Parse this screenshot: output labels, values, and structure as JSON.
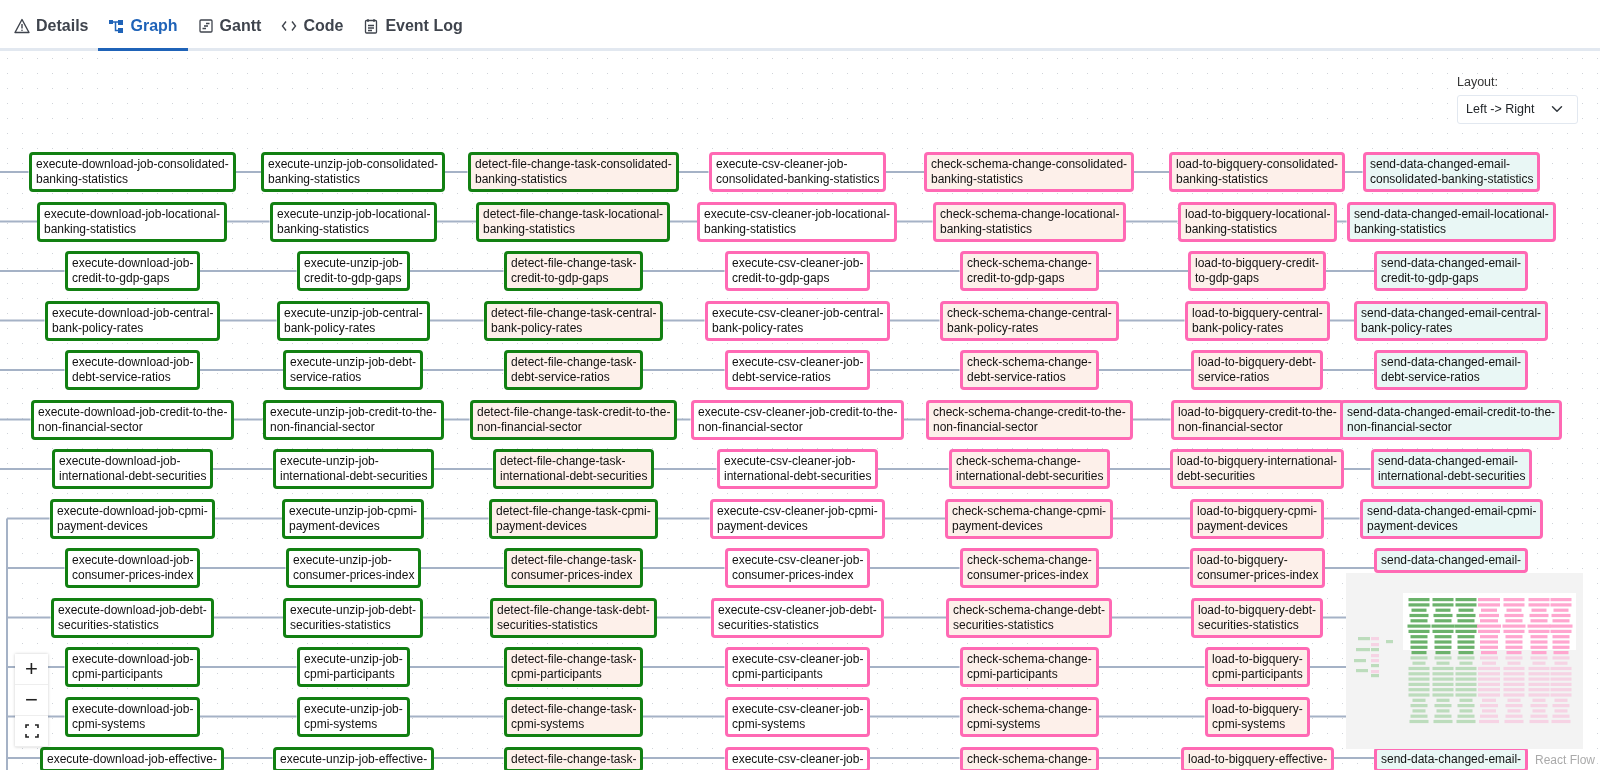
{
  "tabs": [
    {
      "label": "Details",
      "kind": "details",
      "selected": false
    },
    {
      "label": "Graph",
      "kind": "graph",
      "selected": true
    },
    {
      "label": "Gantt",
      "kind": "gantt",
      "selected": false
    },
    {
      "label": "Code",
      "kind": "code",
      "selected": false
    },
    {
      "label": "Event Log",
      "kind": "log",
      "selected": false
    }
  ],
  "layout": {
    "label": "Layout:",
    "value": "Left -> Right"
  },
  "graph": {
    "columns": [
      {
        "color": "#128012",
        "kind": "bash"
      },
      {
        "color": "#128012",
        "kind": "bash"
      },
      {
        "color": "#128012",
        "kind": "python"
      },
      {
        "color": "#ff69b4",
        "kind": "bash"
      },
      {
        "color": "#ff69b4",
        "kind": "python"
      },
      {
        "color": "#ff69b4",
        "kind": "python"
      },
      {
        "color": "#ff69b4",
        "kind": "email"
      }
    ],
    "rows": [
      {
        "nodes": [
          "execute-download-job-consolidated-\nbanking-statistics",
          "execute-unzip-job-consolidated-\nbanking-statistics",
          "detect-file-change-task-consolidated-\nbanking-statistics",
          "execute-csv-cleaner-job-\nconsolidated-banking-statistics",
          "check-schema-change-consolidated-\nbanking-statistics",
          "load-to-bigquery-consolidated-\nbanking-statistics",
          "send-data-changed-email-\nconsolidated-banking-statistics"
        ]
      },
      {
        "nodes": [
          "execute-download-job-locational-\nbanking-statistics",
          "execute-unzip-job-locational-\nbanking-statistics",
          "detect-file-change-task-locational-\nbanking-statistics",
          "execute-csv-cleaner-job-locational-\nbanking-statistics",
          "check-schema-change-locational-\nbanking-statistics",
          "load-to-bigquery-locational-\nbanking-statistics",
          "send-data-changed-email-locational-\nbanking-statistics"
        ]
      },
      {
        "nodes": [
          "execute-download-job-\ncredit-to-gdp-gaps",
          "execute-unzip-job-\ncredit-to-gdp-gaps",
          "detect-file-change-task-\ncredit-to-gdp-gaps",
          "execute-csv-cleaner-job-\ncredit-to-gdp-gaps",
          "check-schema-change-\ncredit-to-gdp-gaps",
          "load-to-bigquery-credit-\nto-gdp-gaps",
          "send-data-changed-email-\ncredit-to-gdp-gaps"
        ]
      },
      {
        "nodes": [
          "execute-download-job-central-\nbank-policy-rates",
          "execute-unzip-job-central-\nbank-policy-rates",
          "detect-file-change-task-central-\nbank-policy-rates",
          "execute-csv-cleaner-job-central-\nbank-policy-rates",
          "check-schema-change-central-\nbank-policy-rates",
          "load-to-bigquery-central-\nbank-policy-rates",
          "send-data-changed-email-central-\nbank-policy-rates"
        ]
      },
      {
        "nodes": [
          "execute-download-job-\ndebt-service-ratios",
          "execute-unzip-job-debt-\nservice-ratios",
          "detect-file-change-task-\ndebt-service-ratios",
          "execute-csv-cleaner-job-\ndebt-service-ratios",
          "check-schema-change-\ndebt-service-ratios",
          "load-to-bigquery-debt-\nservice-ratios",
          "send-data-changed-email-\ndebt-service-ratios"
        ]
      },
      {
        "nodes": [
          "execute-download-job-credit-to-the-\nnon-financial-sector",
          "execute-unzip-job-credit-to-the-\nnon-financial-sector",
          "detect-file-change-task-credit-to-the-\nnon-financial-sector",
          "execute-csv-cleaner-job-credit-to-the-\nnon-financial-sector",
          "check-schema-change-credit-to-the-\nnon-financial-sector",
          "load-to-bigquery-credit-to-the-\nnon-financial-sector",
          "send-data-changed-email-credit-to-the-\nnon-financial-sector"
        ]
      },
      {
        "nodes": [
          "execute-download-job-\ninternational-debt-securities",
          "execute-unzip-job-\ninternational-debt-securities",
          "detect-file-change-task-\ninternational-debt-securities",
          "execute-csv-cleaner-job-\ninternational-debt-securities",
          "check-schema-change-\ninternational-debt-securities",
          "load-to-bigquery-international-\ndebt-securities",
          "send-data-changed-email-\ninternational-debt-securities"
        ]
      },
      {
        "nodes": [
          "execute-download-job-cpmi-\npayment-devices",
          "execute-unzip-job-cpmi-\npayment-devices",
          "detect-file-change-task-cpmi-\npayment-devices",
          "execute-csv-cleaner-job-cpmi-\npayment-devices",
          "check-schema-change-cpmi-\npayment-devices",
          "load-to-bigquery-cpmi-\npayment-devices",
          "send-data-changed-email-cpmi-\npayment-devices"
        ]
      },
      {
        "nodes": [
          "execute-download-job-\nconsumer-prices-index",
          "execute-unzip-job-\nconsumer-prices-index",
          "detect-file-change-task-\nconsumer-prices-index",
          "execute-csv-cleaner-job-\nconsumer-prices-index",
          "check-schema-change-\nconsumer-prices-index",
          "load-to-bigquery-\nconsumer-prices-index",
          "send-data-changed-email-"
        ]
      },
      {
        "nodes": [
          "execute-download-job-debt-\nsecurities-statistics",
          "execute-unzip-job-debt-\nsecurities-statistics",
          "detect-file-change-task-debt-\nsecurities-statistics",
          "execute-csv-cleaner-job-debt-\nsecurities-statistics",
          "check-schema-change-debt-\nsecurities-statistics",
          "load-to-bigquery-debt-\nsecurities-statistics"
        ]
      },
      {
        "nodes": [
          "execute-download-job-\ncpmi-participants",
          "execute-unzip-job-\ncpmi-participants",
          "detect-file-change-task-\ncpmi-participants",
          "execute-csv-cleaner-job-\ncpmi-participants",
          "check-schema-change-\ncpmi-participants",
          "load-to-bigquery-\ncpmi-participants"
        ]
      },
      {
        "nodes": [
          "execute-download-job-\ncpmi-systems",
          "execute-unzip-job-\ncpmi-systems",
          "detect-file-change-task-\ncpmi-systems",
          "execute-csv-cleaner-job-\ncpmi-systems",
          "check-schema-change-\ncpmi-systems",
          "load-to-bigquery-\ncpmi-systems"
        ]
      },
      {
        "nodes": [
          "execute-download-job-effective-",
          "execute-unzip-job-effective-",
          "detect-file-change-task-",
          "execute-csv-cleaner-job-",
          "check-schema-change-",
          "load-to-bigquery-effective-",
          "send-data-changed-email-"
        ]
      }
    ]
  },
  "controls": [
    {
      "kind": "zoom_in",
      "label": "+"
    },
    {
      "kind": "zoom_out",
      "label": "−"
    },
    {
      "kind": "fit_view"
    }
  ],
  "attribution": "React Flow"
}
